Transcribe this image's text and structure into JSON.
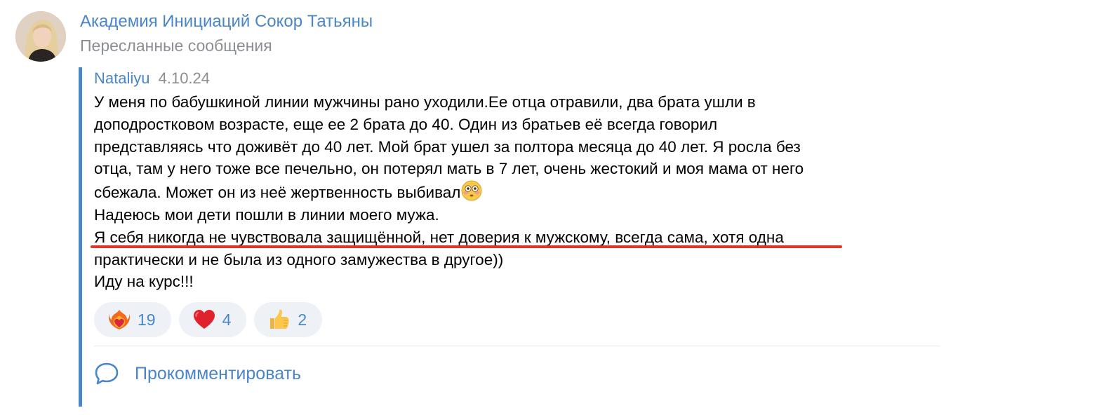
{
  "channel": {
    "name": "Академия Инициаций Сокор Татьяны",
    "subtitle": "Пересланные сообщения"
  },
  "message": {
    "author": "Nataliyu",
    "date": "4.10.24",
    "lines": [
      "У меня по бабушкиной линии мужчины рано уходили.Ее отца отравили, два брата ушли в",
      "доподростковом возрасте, еще ее 2 брата до 40. Один из братьев её всегда говорил",
      "представляясь что доживёт до 40 лет. Мой брат ушел за полтора месяца до 40 лет. Я росла без",
      "отца, там у него тоже все печельно, он потерял мать в 7 лет, очень жестокий и моя мама от него",
      "сбежала. Может он из неё жертвенность выбивал",
      "Надеюсь мои дети пошли в линии моего мужа.",
      "Я себя никогда не чувствовала защищённой, нет доверия к мужскому,  всегда сама, хотя одна",
      "практически и не была из одного замужества в другое))",
      "Иду на курс!!!"
    ],
    "inline_emoji": "flushed-face-emoji"
  },
  "reactions": [
    {
      "icon": "heart-on-fire-icon",
      "count": "19"
    },
    {
      "icon": "red-heart-icon",
      "count": "4"
    },
    {
      "icon": "thumbs-up-icon",
      "count": "2"
    }
  ],
  "comment": {
    "label": "Прокомментировать",
    "icon": "speech-bubble-icon"
  },
  "colors": {
    "link": "#4a86c6",
    "muted": "#8b8f94",
    "quote_bar": "#4b86c8",
    "underline": "#e0352b",
    "reaction_bg": "#eef2f7"
  }
}
